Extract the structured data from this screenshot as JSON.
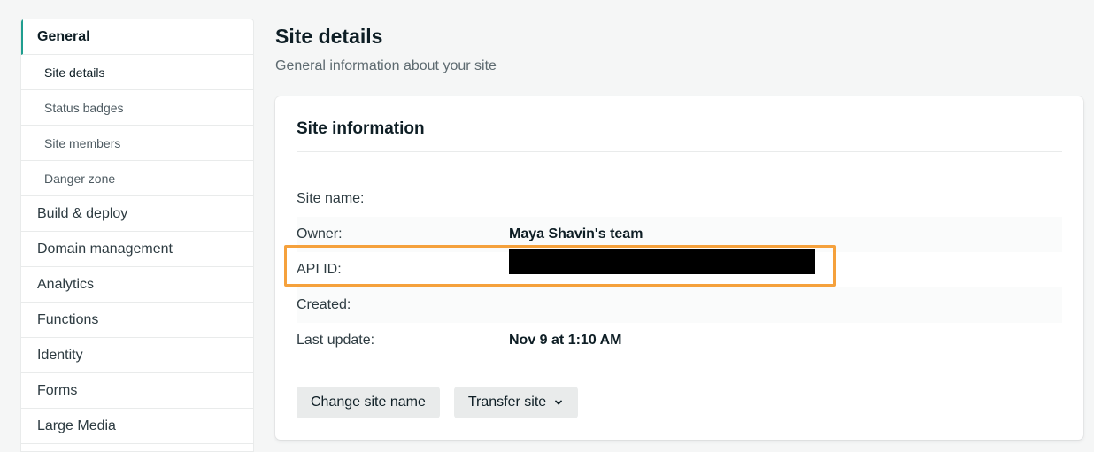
{
  "sidebar": {
    "items": [
      {
        "label": "General",
        "kind": "top",
        "active": true
      },
      {
        "label": "Site details",
        "kind": "sub",
        "active": true
      },
      {
        "label": "Status badges",
        "kind": "sub"
      },
      {
        "label": "Site members",
        "kind": "sub"
      },
      {
        "label": "Danger zone",
        "kind": "sub"
      },
      {
        "label": "Build & deploy",
        "kind": "top"
      },
      {
        "label": "Domain management",
        "kind": "top"
      },
      {
        "label": "Analytics",
        "kind": "top"
      },
      {
        "label": "Functions",
        "kind": "top"
      },
      {
        "label": "Identity",
        "kind": "top"
      },
      {
        "label": "Forms",
        "kind": "top"
      },
      {
        "label": "Large Media",
        "kind": "top"
      }
    ]
  },
  "main": {
    "title": "Site details",
    "subtitle": "General information about your site",
    "card": {
      "title": "Site information",
      "rows": [
        {
          "label": "Site name:",
          "value": ""
        },
        {
          "label": "Owner:",
          "value": "Maya Shavin's team"
        },
        {
          "label": "API ID:",
          "value": "",
          "redacted": true
        },
        {
          "label": "Created:",
          "value": ""
        },
        {
          "label": "Last update:",
          "value": "Nov 9 at 1:10 AM"
        }
      ],
      "buttons": {
        "change_name": "Change site name",
        "transfer": "Transfer site"
      }
    }
  },
  "colors": {
    "accent": "#1f9e8f",
    "highlight": "#f5a13c",
    "button_bg": "#e9ebeb"
  }
}
